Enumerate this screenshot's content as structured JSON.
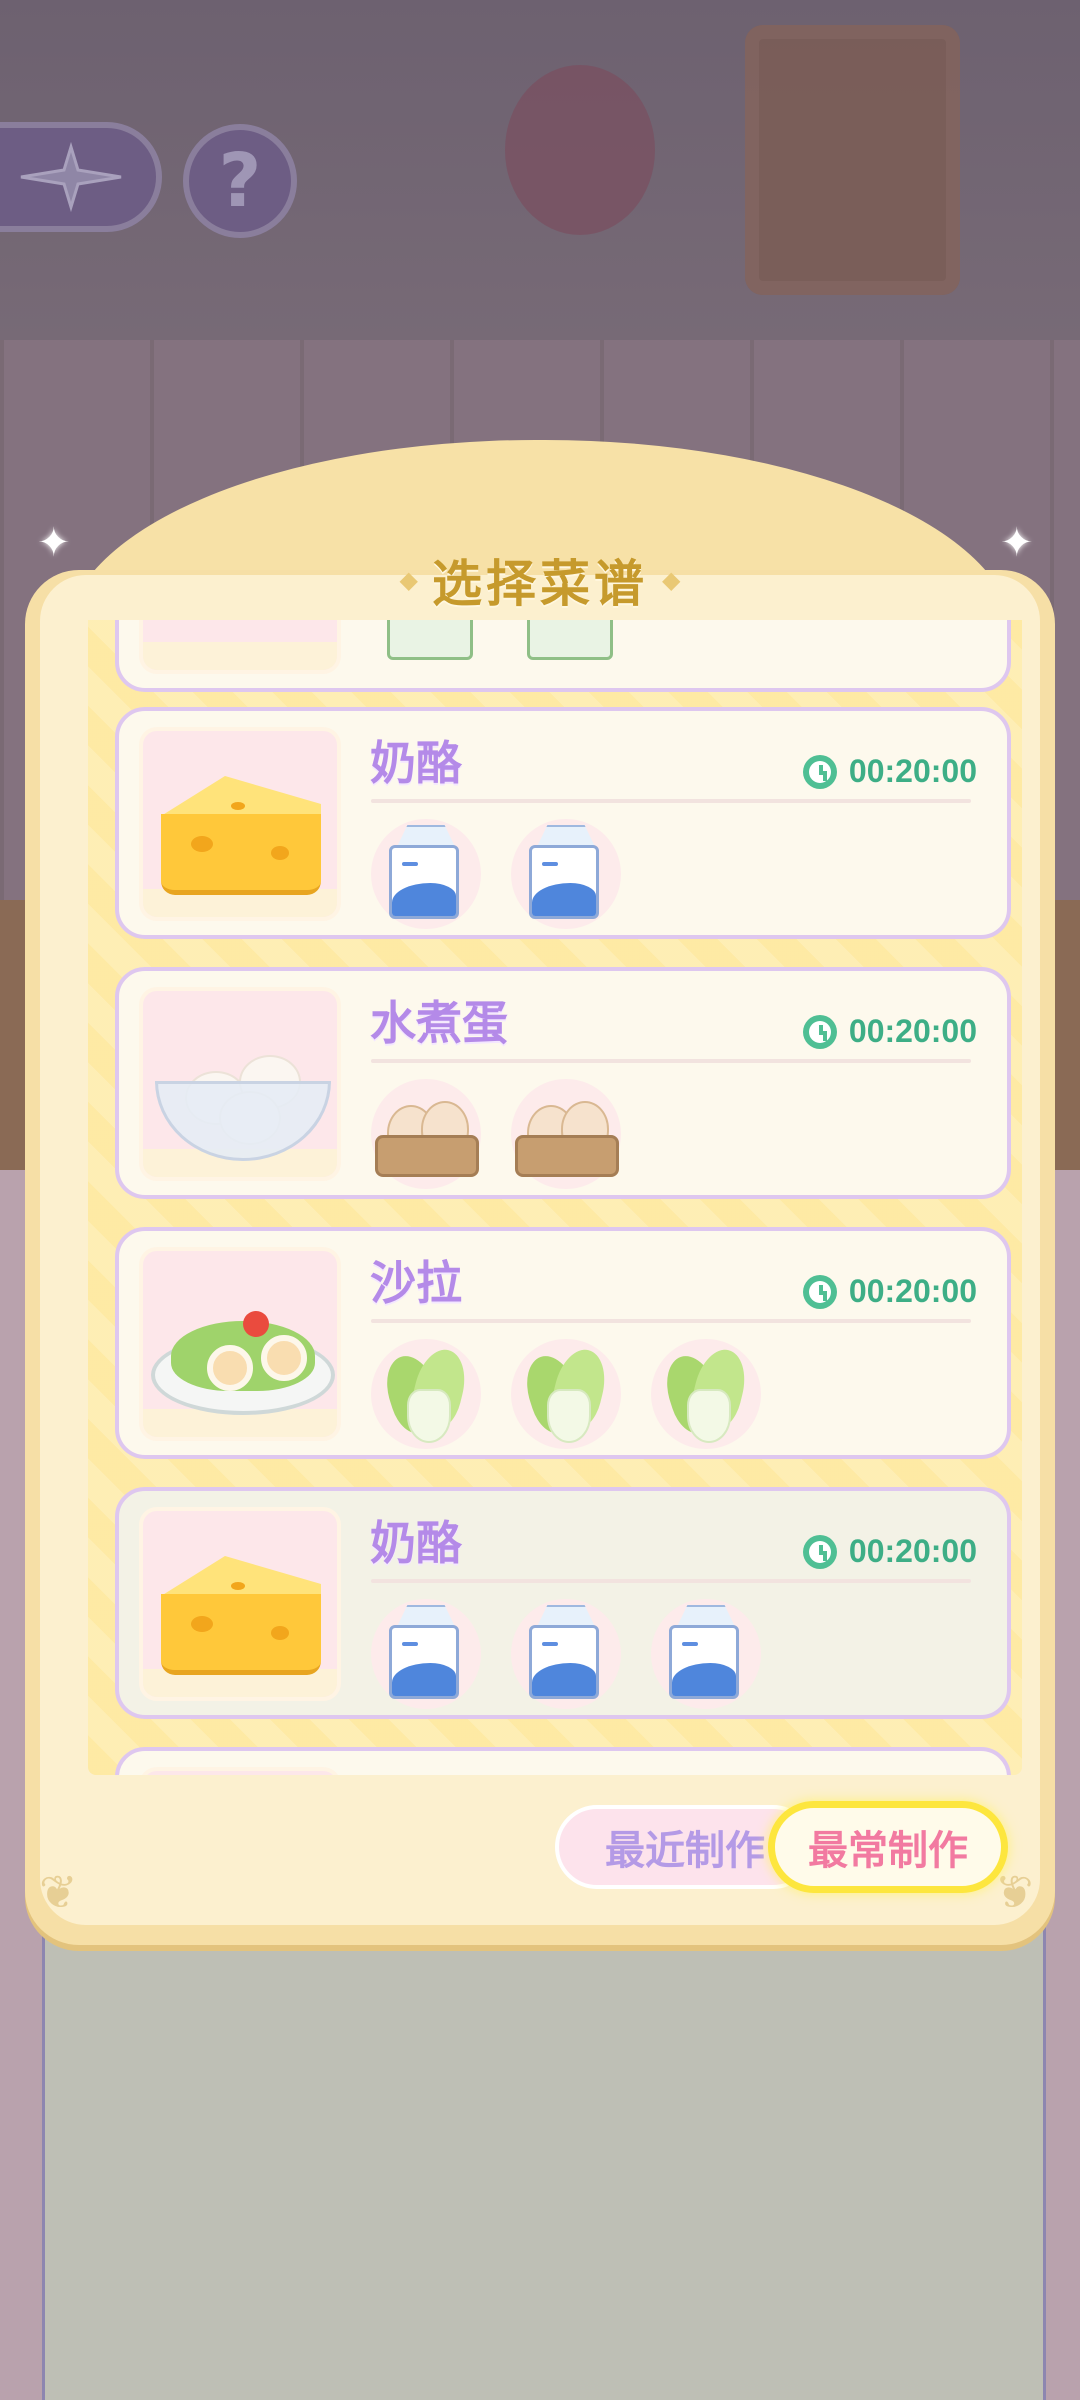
{
  "dialog": {
    "title": "选择菜谱"
  },
  "recipes": [
    {
      "name": "",
      "timer": "",
      "dish": "partial",
      "ingredients": [
        "flour-bag-icon",
        "flour-bag-icon"
      ]
    },
    {
      "name": "奶酪",
      "timer": "00:20:00",
      "dish": "cheese-icon",
      "ingredients": [
        "milk-carton-icon",
        "milk-carton-icon"
      ]
    },
    {
      "name": "水煮蛋",
      "timer": "00:20:00",
      "dish": "boiled-eggs-bowl-icon",
      "ingredients": [
        "egg-carton-icon",
        "egg-carton-icon"
      ]
    },
    {
      "name": "沙拉",
      "timer": "00:20:00",
      "dish": "salad-plate-icon",
      "ingredients": [
        "cabbage-icon",
        "cabbage-icon",
        "cabbage-icon"
      ]
    },
    {
      "name": "奶酪",
      "timer": "00:20:00",
      "dish": "cheese-icon",
      "ingredients": [
        "milk-carton-icon",
        "milk-carton-icon",
        "milk-carton-icon"
      ],
      "selected": true
    },
    {
      "name": "",
      "timer": "",
      "dish": "partial",
      "ingredients": []
    }
  ],
  "filters": {
    "recent_label": "最近制作",
    "most_label": "最常制作",
    "active": "most"
  },
  "hud": {
    "help_label": "?"
  },
  "colors": {
    "recipe_name": "#b48ae8",
    "timer": "#3dae86",
    "title": "#c69a2c",
    "active_filter_border": "#fde63e"
  }
}
